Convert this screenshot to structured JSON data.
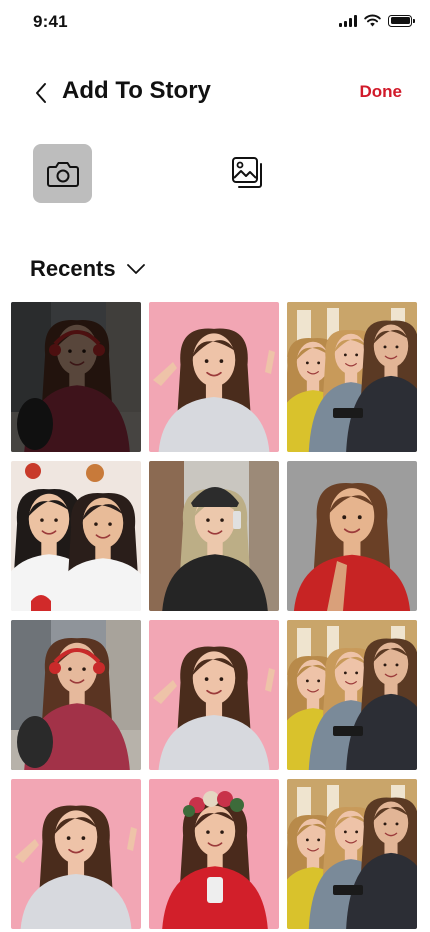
{
  "status_bar": {
    "time": "9:41",
    "icons": [
      "signal-icon",
      "wifi-icon",
      "battery-icon"
    ]
  },
  "header": {
    "back_icon": "chevron-left-icon",
    "title": "Add To Story",
    "done_label": "Done"
  },
  "sources": [
    {
      "icon": "camera-icon",
      "state": "selected"
    },
    {
      "icon": "gallery-icon",
      "state": "default"
    }
  ],
  "recents": {
    "label": "Recents",
    "chevron_icon": "chevron-down-icon"
  },
  "colors": {
    "accent": "#d11a2a",
    "camera_button_bg": "#bdbdbd",
    "text": "#111111"
  },
  "photos": [
    {
      "scene": "girl-headphones",
      "selected": true
    },
    {
      "scene": "girl-pink-gray",
      "selected": false
    },
    {
      "scene": "group-phone",
      "selected": false
    },
    {
      "scene": "two-girls-selfie",
      "selected": false
    },
    {
      "scene": "girl-beanie-phone",
      "selected": false
    },
    {
      "scene": "woman-red-jacket",
      "selected": false
    },
    {
      "scene": "girl-headphones",
      "selected": false
    },
    {
      "scene": "girl-pink-gray",
      "selected": false
    },
    {
      "scene": "group-phone",
      "selected": false
    },
    {
      "scene": "girl-pink-gray",
      "selected": false
    },
    {
      "scene": "girl-flower-crown",
      "selected": false
    },
    {
      "scene": "group-phone",
      "selected": false
    }
  ]
}
